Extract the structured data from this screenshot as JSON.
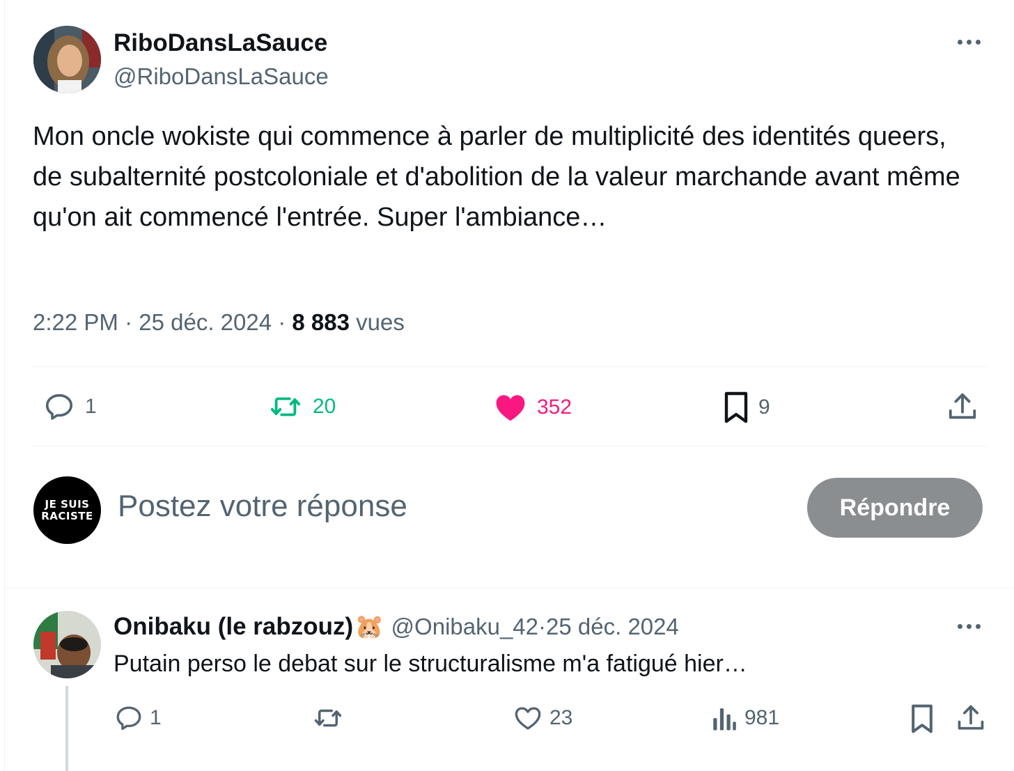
{
  "main_tweet": {
    "author": {
      "display_name": "RiboDansLaSauce",
      "handle": "@RiboDansLaSauce"
    },
    "text": "Mon oncle wokiste qui commence à parler de multiplicité des identités queers, de subalternité postcoloniale et d'abolition de la valeur marchande avant même qu'on ait commencé l'entrée. Super l'ambiance…",
    "time": "2:22 PM",
    "separator": " · ",
    "date": "25 déc. 2024",
    "views_count": "8 883",
    "views_label": " vues",
    "actions": {
      "replies": "1",
      "retweets": "20",
      "likes": "352",
      "bookmarks": "9"
    },
    "colors": {
      "retweet": "#00ba7c",
      "like": "#f91880"
    }
  },
  "compose": {
    "avatar_text_line1": "JE SUIS",
    "avatar_text_line2": "RACISTE",
    "placeholder": "Postez votre réponse",
    "button_label": "Répondre"
  },
  "reply_tweet": {
    "author": {
      "display_name": "Onibaku (le rabzouz)",
      "emoji": "🐹",
      "handle": "@Onibaku_42",
      "date": "25 déc. 2024"
    },
    "text": "Putain perso le debat sur le structuralisme m'a fatigué hier…",
    "actions": {
      "replies": "1",
      "retweets": "",
      "likes": "23",
      "views": "981"
    }
  }
}
